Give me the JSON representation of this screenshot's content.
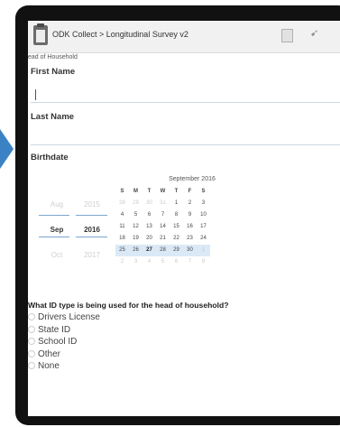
{
  "app": {
    "title": "ODK Collect > Longitudinal Survey v2"
  },
  "breadcrumb": "ead of Household",
  "fields": {
    "first_name": {
      "label": "First Name",
      "value": ""
    },
    "last_name": {
      "label": "Last Name",
      "value": ""
    }
  },
  "birthdate": {
    "label": "Birthdate",
    "months": [
      "Aug",
      "Sep",
      "Oct"
    ],
    "years": [
      "2015",
      "2016",
      "2017"
    ],
    "calendar": {
      "title": "September 2016",
      "weekdays": [
        "S",
        "M",
        "T",
        "W",
        "T",
        "F",
        "S"
      ],
      "weeks": [
        [
          "28",
          "29",
          "30",
          "31",
          "1",
          "2",
          "3"
        ],
        [
          "4",
          "5",
          "6",
          "7",
          "8",
          "9",
          "10"
        ],
        [
          "11",
          "12",
          "13",
          "14",
          "15",
          "16",
          "17"
        ],
        [
          "18",
          "19",
          "20",
          "21",
          "22",
          "23",
          "24"
        ],
        [
          "25",
          "26",
          "27",
          "28",
          "29",
          "30",
          "1"
        ],
        [
          "2",
          "3",
          "4",
          "5",
          "6",
          "7",
          "8"
        ]
      ],
      "highlighted_week": 4,
      "selected_day": "27"
    }
  },
  "id_question": {
    "label": "What ID type is being used for the head of household?",
    "options": [
      "Drivers License",
      "State ID",
      "School ID",
      "Other",
      "None"
    ]
  },
  "colors": {
    "accent": "#3b82c4",
    "highlight": "#dbe9f6"
  }
}
